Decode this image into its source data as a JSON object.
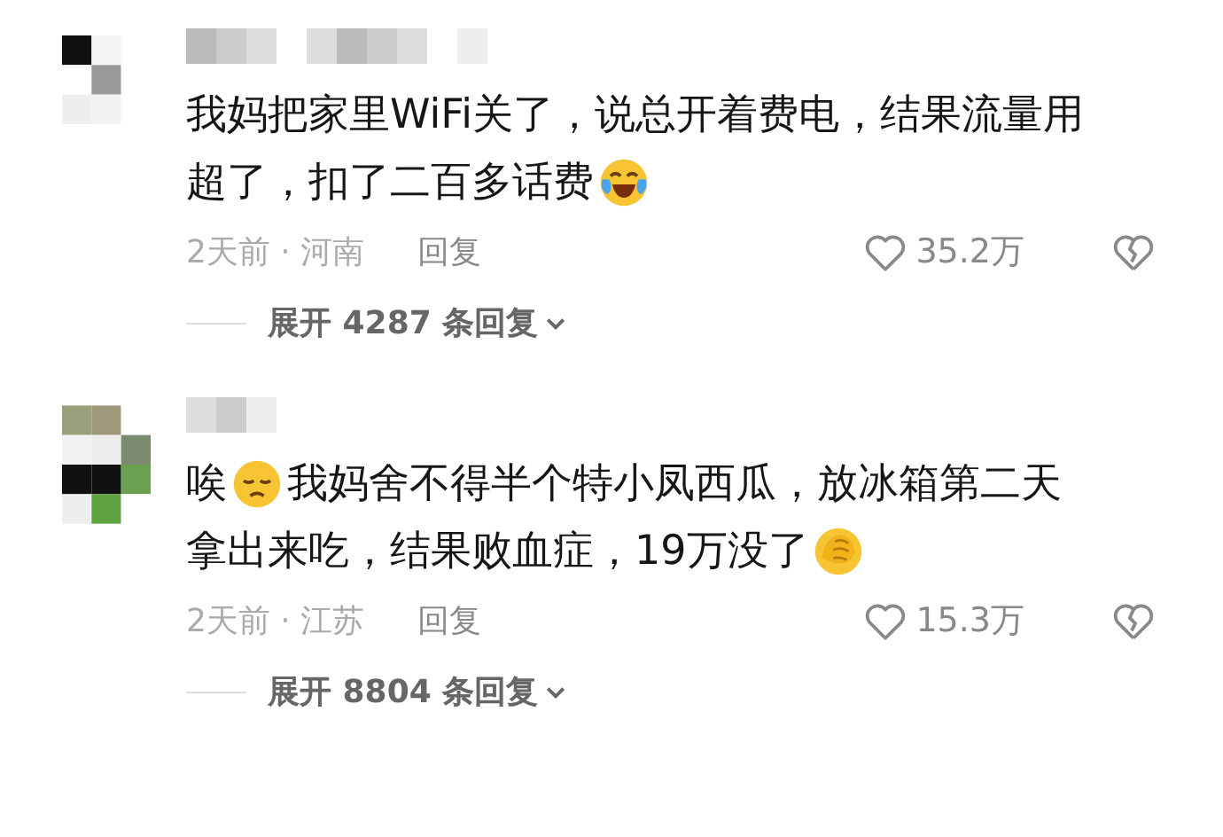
{
  "comments": [
    {
      "body": [
        [
          {
            "kind": "text",
            "text": "我妈把家里WiFi关了，说总开着费电，结果流量用"
          }
        ],
        [
          {
            "kind": "text",
            "text": "超了，扣了二百多话费"
          },
          {
            "kind": "emoji"
          }
        ]
      ],
      "time_location": "2天前 · 河南",
      "reply": "回复",
      "likes": "35.2万",
      "expand": "展开 4287 条回复"
    },
    {
      "body": [
        [
          {
            "kind": "text",
            "text": "唉"
          },
          {
            "kind": "emoji"
          },
          {
            "kind": "text",
            "text": "我妈舍不得半个特小凤西瓜，放冰箱第二天"
          }
        ],
        [
          {
            "kind": "text",
            "text": "拿出来吃，结果败血症，19万没了"
          },
          {
            "kind": "emoji"
          }
        ]
      ],
      "time_location": "2天前 · 江苏",
      "reply": "回复",
      "likes": "15.3万",
      "expand": "展开 8804 条回复"
    }
  ]
}
